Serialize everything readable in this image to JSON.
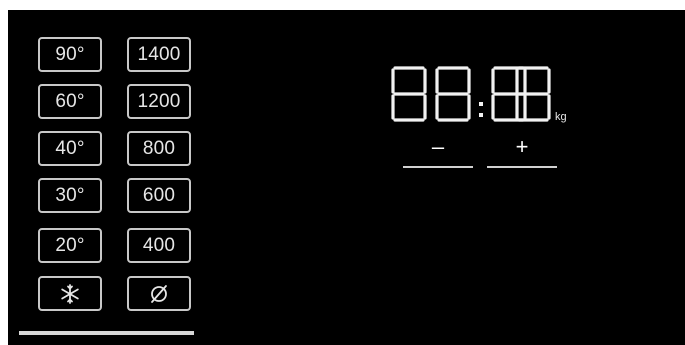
{
  "temperature_buttons": [
    {
      "label": "90°"
    },
    {
      "label": "60°"
    },
    {
      "label": "40°"
    },
    {
      "label": "30°"
    },
    {
      "label": "20°"
    }
  ],
  "spin_buttons": [
    {
      "label": "1400"
    },
    {
      "label": "1200"
    },
    {
      "label": "800"
    },
    {
      "label": "600"
    },
    {
      "label": "400"
    }
  ],
  "cold_button": {
    "icon": "snowflake-icon"
  },
  "no_spin_button": {
    "icon": "no-spin-icon"
  },
  "display": {
    "digits": [
      "8",
      "8",
      "8",
      "8"
    ],
    "separator": ":",
    "unit": "kg"
  },
  "adjust": {
    "minus_label": "–",
    "plus_label": "+"
  },
  "colors": {
    "panel": "#000000",
    "segment": "#f2f2f2",
    "outline": "#c8c8c8"
  }
}
